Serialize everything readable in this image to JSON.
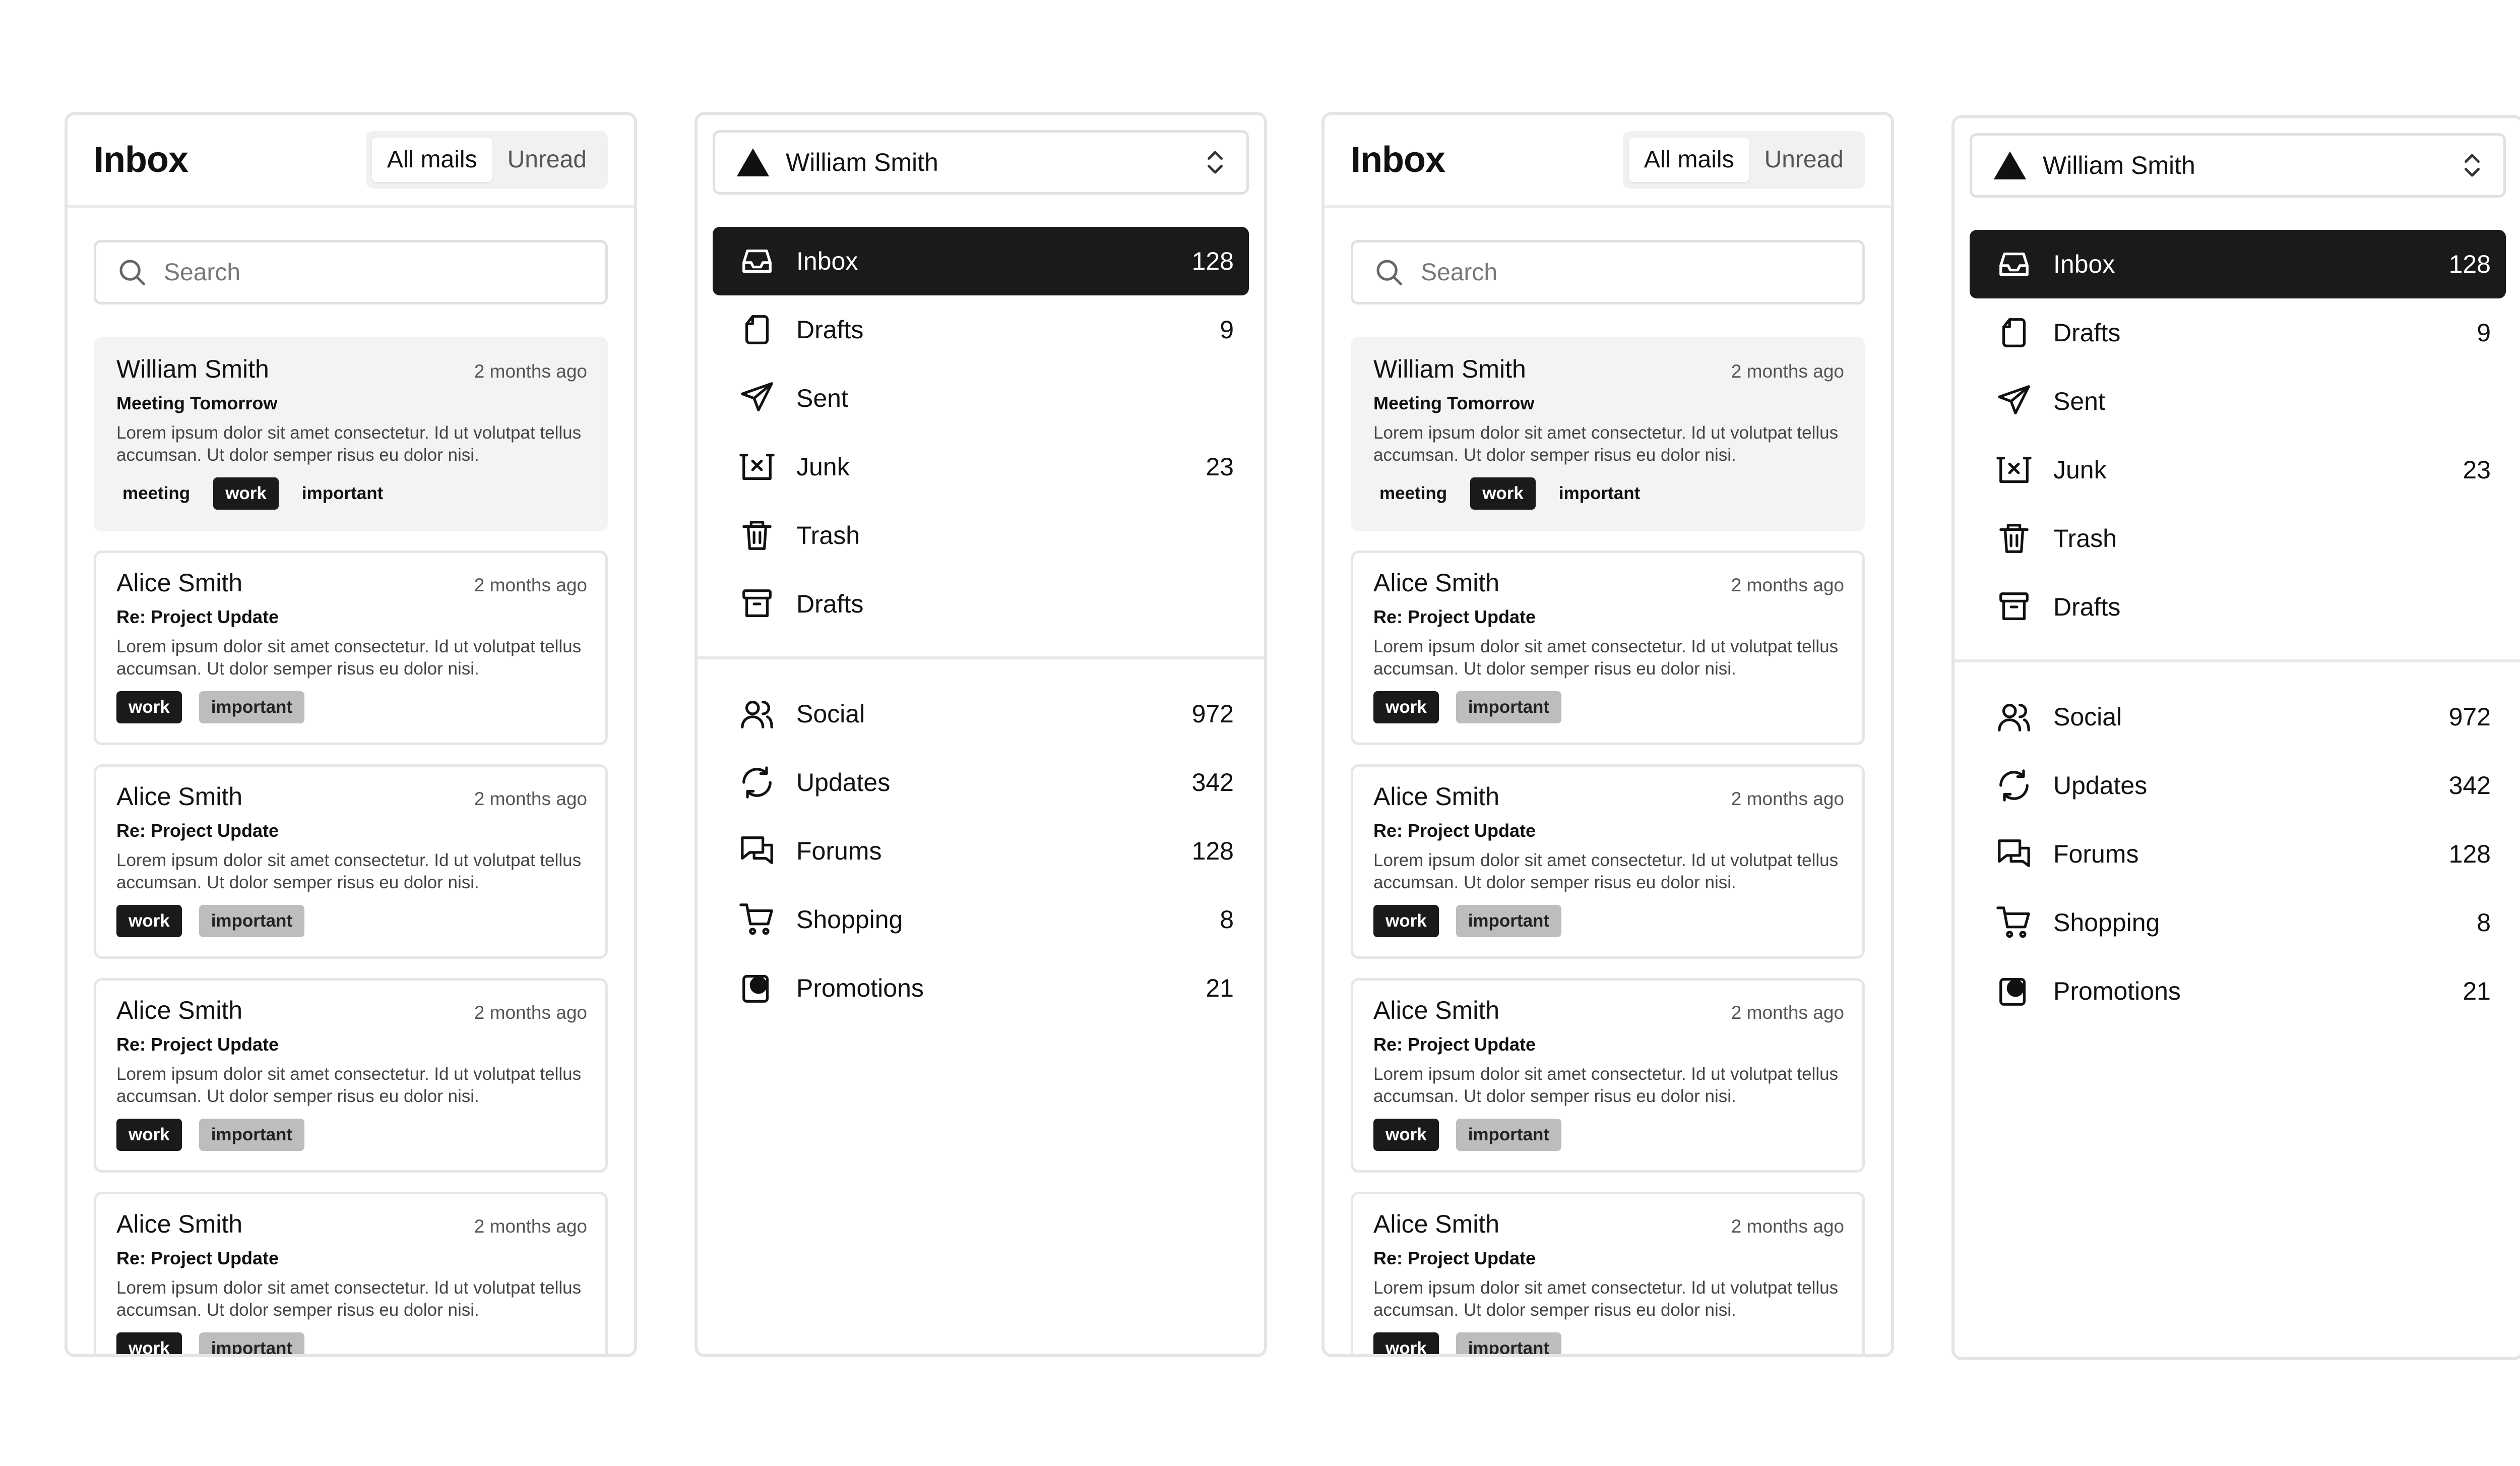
{
  "inbox": {
    "title": "Inbox",
    "filters": [
      "All mails",
      "Unread"
    ],
    "search_placeholder": "Search",
    "mails": [
      {
        "from": "William Smith",
        "date": "2 months ago",
        "subject": "Meeting Tomorrow",
        "preview": "Lorem ipsum dolor sit amet consectetur. Id ut volutpat tellus accumsan. Ut dolor semper risus eu dolor nisi.",
        "tags": [
          "meeting",
          "work",
          "important"
        ]
      },
      {
        "from": "Alice Smith",
        "date": "2 months ago",
        "subject": "Re: Project Update",
        "preview": "Lorem ipsum dolor sit amet consectetur. Id ut volutpat tellus accumsan. Ut dolor semper risus eu dolor nisi.",
        "tags": [
          "work",
          "important"
        ]
      },
      {
        "from": "Alice Smith",
        "date": "2 months ago",
        "subject": "Re: Project Update",
        "preview": "Lorem ipsum dolor sit amet consectetur. Id ut volutpat tellus accumsan. Ut dolor semper risus eu dolor nisi.",
        "tags": [
          "work",
          "important"
        ]
      },
      {
        "from": "Alice Smith",
        "date": "2 months ago",
        "subject": "Re: Project Update",
        "preview": "Lorem ipsum dolor sit amet consectetur. Id ut volutpat tellus accumsan. Ut dolor semper risus eu dolor nisi.",
        "tags": [
          "work",
          "important"
        ]
      },
      {
        "from": "Alice Smith",
        "date": "2 months ago",
        "subject": "Re: Project Update",
        "preview": "Lorem ipsum dolor sit amet consectetur. Id ut volutpat tellus accumsan. Ut dolor semper risus eu dolor nisi.",
        "tags": [
          "work",
          "important"
        ]
      }
    ]
  },
  "nav": {
    "account_name": "William Smith",
    "primary": [
      {
        "label": "Inbox",
        "count": "128",
        "icon": "inbox-icon"
      },
      {
        "label": "Drafts",
        "count": "9",
        "icon": "file-icon"
      },
      {
        "label": "Sent",
        "count": "",
        "icon": "send-icon"
      },
      {
        "label": "Junk",
        "count": "23",
        "icon": "archive-x-icon"
      },
      {
        "label": "Trash",
        "count": "",
        "icon": "trash-icon"
      },
      {
        "label": "Drafts",
        "count": "",
        "icon": "archive-icon"
      }
    ],
    "secondary": [
      {
        "label": "Social",
        "count": "972",
        "icon": "users-icon"
      },
      {
        "label": "Updates",
        "count": "342",
        "icon": "refresh-icon"
      },
      {
        "label": "Forums",
        "count": "128",
        "icon": "messages-icon"
      },
      {
        "label": "Shopping",
        "count": "8",
        "icon": "cart-icon"
      },
      {
        "label": "Promotions",
        "count": "21",
        "icon": "promotions-icon"
      }
    ]
  },
  "colors": {
    "active_bg": "#1a1a1a",
    "border": "#e5e5e5",
    "tag_gray": "#bdbdbd"
  }
}
